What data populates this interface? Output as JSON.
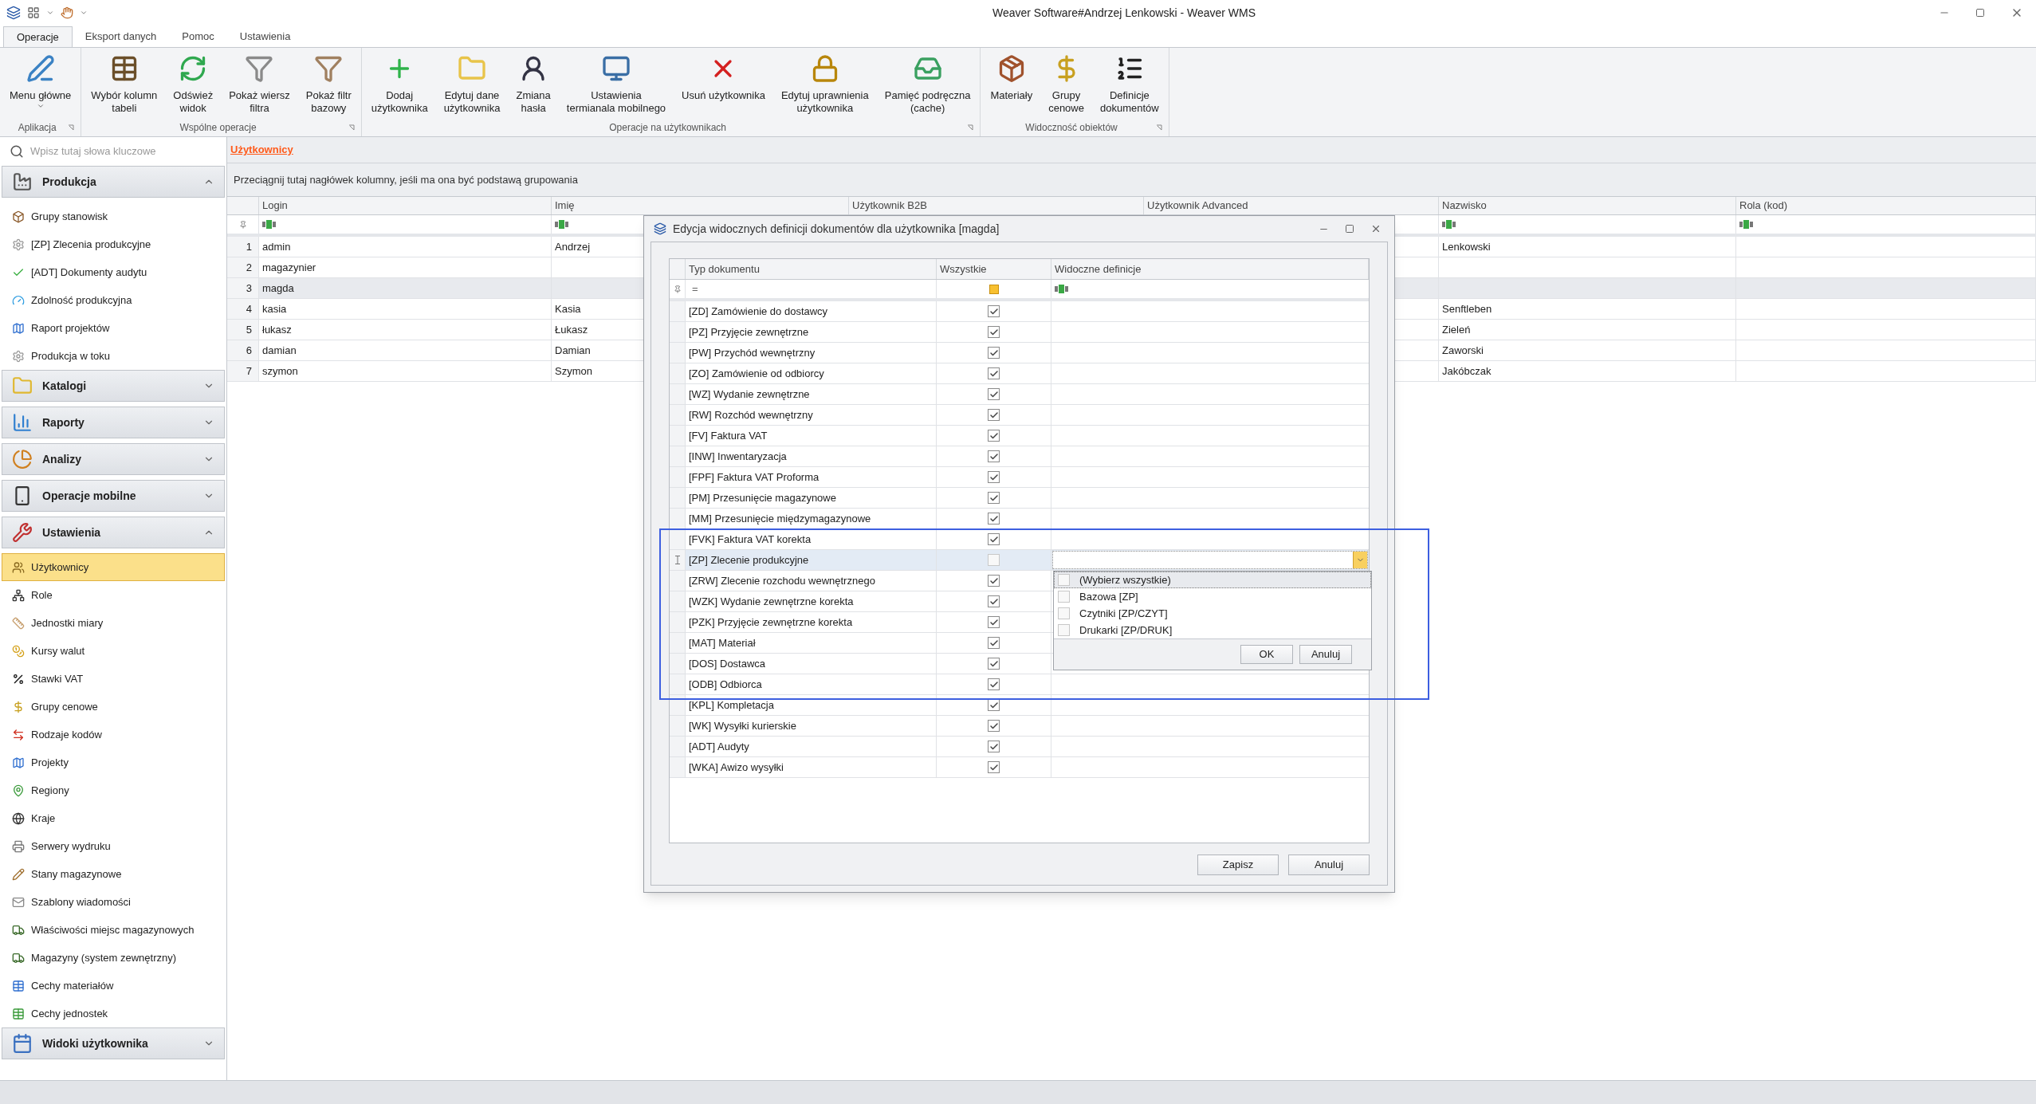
{
  "window": {
    "title": "Weaver Software#Andrzej Lenkowski - Weaver WMS"
  },
  "ribbon": {
    "tabs": [
      {
        "label": "Operacje",
        "selected": true
      },
      {
        "label": "Eksport danych",
        "selected": false
      },
      {
        "label": "Pomoc",
        "selected": false
      },
      {
        "label": "Ustawienia",
        "selected": false
      }
    ],
    "groups": [
      {
        "label": "Aplikacja",
        "buttons": [
          {
            "label": "Menu główne",
            "dropdown": true
          }
        ]
      },
      {
        "label": "Wspólne operacje",
        "buttons": [
          {
            "label": "Wybór kolumn\ntabeli",
            "dropdown": false
          },
          {
            "label": "Odśwież\nwidok",
            "dropdown": false
          },
          {
            "label": "Pokaż wiersz\nfiltra",
            "dropdown": false
          },
          {
            "label": "Pokaż filtr\nbazowy",
            "dropdown": false
          }
        ]
      },
      {
        "label": "Operacje na użytkownikach",
        "buttons": [
          {
            "label": "Dodaj\nużytkownika",
            "dropdown": false
          },
          {
            "label": "Edytuj dane\nużytkownika",
            "dropdown": false
          },
          {
            "label": "Zmiana\nhasła",
            "dropdown": false
          },
          {
            "label": "Ustawienia\ntermianala mobilnego",
            "dropdown": false
          },
          {
            "label": "Usuń użytkownika",
            "dropdown": false
          },
          {
            "label": "Edytuj uprawnienia\nużytkownika",
            "dropdown": false
          },
          {
            "label": "Pamięć podręczna\n(cache)",
            "dropdown": false
          }
        ]
      },
      {
        "label": "Widoczność obiektów",
        "buttons": [
          {
            "label": "Materiały",
            "dropdown": false
          },
          {
            "label": "Grupy\ncenowe",
            "dropdown": false
          },
          {
            "label": "Definicje\ndokumentów",
            "dropdown": false
          }
        ]
      }
    ]
  },
  "sidebar": {
    "search": {
      "placeholder": "Wpisz tutaj słowa kluczowe"
    },
    "groups": [
      {
        "label": "Produkcja",
        "expanded": true,
        "items": [
          {
            "label": "Grupy stanowisk",
            "selected": false
          },
          {
            "label": "[ZP] Zlecenia produkcyjne",
            "selected": false
          },
          {
            "label": "[ADT] Dokumenty audytu",
            "selected": false
          },
          {
            "label": "Zdolność produkcyjna",
            "selected": false
          },
          {
            "label": "Raport projektów",
            "selected": false
          },
          {
            "label": "Produkcja w toku",
            "selected": false
          }
        ]
      },
      {
        "label": "Katalogi",
        "expanded": false
      },
      {
        "label": "Raporty",
        "expanded": false
      },
      {
        "label": "Analizy",
        "expanded": false
      },
      {
        "label": "Operacje mobilne",
        "expanded": false
      },
      {
        "label": "Ustawienia",
        "expanded": true,
        "items": [
          {
            "label": "Użytkownicy",
            "selected": true
          },
          {
            "label": "Role",
            "selected": false
          },
          {
            "label": "Jednostki miary",
            "selected": false
          },
          {
            "label": "Kursy walut",
            "selected": false
          },
          {
            "label": "Stawki VAT",
            "selected": false
          },
          {
            "label": "Grupy cenowe",
            "selected": false
          },
          {
            "label": "Rodzaje kodów",
            "selected": false
          },
          {
            "label": "Projekty",
            "selected": false
          },
          {
            "label": "Regiony",
            "selected": false
          },
          {
            "label": "Kraje",
            "selected": false
          },
          {
            "label": "Serwery wydruku",
            "selected": false
          },
          {
            "label": "Stany magazynowe",
            "selected": false
          },
          {
            "label": "Szablony wiadomości",
            "selected": false
          },
          {
            "label": "Właściwości miejsc magazynowych",
            "selected": false
          },
          {
            "label": "Magazyny (system zewnętrzny)",
            "selected": false
          },
          {
            "label": "Cechy materiałów",
            "selected": false
          },
          {
            "label": "Cechy jednostek",
            "selected": false
          }
        ]
      },
      {
        "label": "Widoki użytkownika",
        "expanded": false
      }
    ]
  },
  "content": {
    "title": "Użytkownicy",
    "group_panel": "Przeciągnij tutaj nagłówek kolumny, jeśli ma ona być podstawą grupowania",
    "table": {
      "columns": [
        "Login",
        "Imię",
        "Użytkownik B2B",
        "Użytkownik Advanced",
        "Nazwisko",
        "Rola (kod)"
      ],
      "rows": [
        {
          "num": "1",
          "cells": [
            "admin",
            "Andrzej",
            "",
            "",
            "Lenkowski",
            ""
          ],
          "selected": false
        },
        {
          "num": "2",
          "cells": [
            "magazynier",
            "",
            "",
            "",
            "",
            ""
          ],
          "selected": false
        },
        {
          "num": "3",
          "cells": [
            "magda",
            "",
            "",
            "",
            "",
            ""
          ],
          "selected": true
        },
        {
          "num": "4",
          "cells": [
            "kasia",
            "Kasia",
            "",
            "",
            "Senftleben",
            ""
          ],
          "selected": false
        },
        {
          "num": "5",
          "cells": [
            "łukasz",
            "Łukasz",
            "",
            "",
            "Zieleń",
            ""
          ],
          "selected": false
        },
        {
          "num": "6",
          "cells": [
            "damian",
            "Damian",
            "",
            "",
            "Zaworski",
            ""
          ],
          "selected": false
        },
        {
          "num": "7",
          "cells": [
            "szymon",
            "Szymon",
            "",
            "",
            "Jakóbczak",
            ""
          ],
          "selected": false
        }
      ]
    }
  },
  "dialog": {
    "title": "Edycja widocznych definicji dokumentów dla użytkownika [magda]",
    "columns": [
      "Typ dokumentu",
      "Wszystkie",
      "Widoczne definicje"
    ],
    "filter_operator": "=",
    "filter_indeterminate": true,
    "rows": [
      {
        "label": "[ZD] Zamówienie do dostawcy",
        "all": true,
        "selected": false
      },
      {
        "label": "[PZ] Przyjęcie zewnętrzne",
        "all": true,
        "selected": false
      },
      {
        "label": "[PW] Przychód wewnętrzny",
        "all": true,
        "selected": false
      },
      {
        "label": "[ZO] Zamówienie od odbiorcy",
        "all": true,
        "selected": false
      },
      {
        "label": "[WZ] Wydanie zewnętrzne",
        "all": true,
        "selected": false
      },
      {
        "label": "[RW] Rozchód wewnętrzny",
        "all": true,
        "selected": false
      },
      {
        "label": "[FV] Faktura VAT",
        "all": true,
        "selected": false
      },
      {
        "label": "[INW] Inwentaryzacja",
        "all": true,
        "selected": false
      },
      {
        "label": "[FPF] Faktura VAT Proforma",
        "all": true,
        "selected": false
      },
      {
        "label": "[PM] Przesunięcie magazynowe",
        "all": true,
        "selected": false
      },
      {
        "label": "[MM] Przesunięcie międzymagazynowe",
        "all": true,
        "selected": false
      },
      {
        "label": "[FVK] Faktura VAT korekta",
        "all": true,
        "selected": false
      },
      {
        "label": "[ZP] Zlecenie produkcyjne",
        "all": false,
        "selected": true,
        "editor": {
          "options": [
            {
              "label": "(Wybierz wszystkie)",
              "checked": false,
              "focused": true
            },
            {
              "label": "Bazowa [ZP]",
              "checked": false,
              "focused": false
            },
            {
              "label": "Czytniki [ZP/CZYT]",
              "checked": false,
              "focused": false
            },
            {
              "label": "Drukarki [ZP/DRUK]",
              "checked": false,
              "focused": false
            }
          ],
          "buttons": [
            "OK",
            "Anuluj"
          ]
        }
      },
      {
        "label": "[ZRW] Zlecenie rozchodu wewnętrznego",
        "all": true,
        "selected": false
      },
      {
        "label": "[WZK] Wydanie zewnętrzne korekta",
        "all": true,
        "selected": false
      },
      {
        "label": "[PZK] Przyjęcie zewnętrzne korekta",
        "all": true,
        "selected": false
      },
      {
        "label": "[MAT] Materiał",
        "all": true,
        "selected": false
      },
      {
        "label": "[DOS] Dostawca",
        "all": true,
        "selected": false
      },
      {
        "label": "[ODB] Odbiorca",
        "all": true,
        "selected": false
      },
      {
        "label": "[KPL] Kompletacja",
        "all": true,
        "selected": false
      },
      {
        "label": "[WK] Wysyłki kurierskie",
        "all": true,
        "selected": false
      },
      {
        "label": "[ADT] Audyty",
        "all": true,
        "selected": false
      },
      {
        "label": "[WKA] Awizo wysyłki",
        "all": true,
        "selected": false
      }
    ],
    "buttons": [
      "Zapisz",
      "Anuluj"
    ]
  }
}
